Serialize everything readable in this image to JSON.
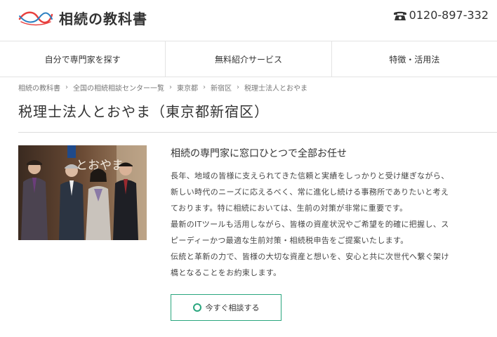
{
  "header": {
    "logo_text": "相続の教科書",
    "phone": "0120-897-332"
  },
  "nav": {
    "items": [
      {
        "label": "自分で専門家を探す"
      },
      {
        "label": "無料紹介サービス"
      },
      {
        "label": "特徴・活用法"
      }
    ]
  },
  "breadcrumb": {
    "items": [
      {
        "label": "相続の教科書"
      },
      {
        "label": "全国の相続相談センター一覧"
      },
      {
        "label": "東京都"
      },
      {
        "label": "新宿区"
      },
      {
        "label": "税理士法人とおやま"
      }
    ],
    "separator": "›"
  },
  "page": {
    "title": "税理士法人とおやま（東京都新宿区）"
  },
  "photo": {
    "sign_text": "とおやま"
  },
  "content": {
    "subtitle": "相続の専門家に窓口ひとつで全部お任せ",
    "lines": [
      "長年、地域の皆様に支えられてきた信頼と実績をしっかりと受け継ぎながら、",
      "新しい時代のニーズに応えるべく、常に進化し続ける事務所でありたいと考え",
      "ております。特に相続においては、生前の対策が非常に重要です。",
      "最新のITツールも活用しながら、皆様の資産状況やご希望を的確に把握し、ス",
      "ピーディーかつ最適な生前対策・相続税申告をご提案いたします。",
      "伝統と革新の力で、皆様の大切な資産と想いを、安心と共に次世代へ繋ぐ架け",
      "橋となることをお約束します。"
    ]
  },
  "cta": {
    "label": "今すぐ相談する"
  },
  "colors": {
    "accent": "#2aa67e",
    "logo_red": "#e8403e",
    "logo_blue": "#2b7fc1"
  },
  "icons": [
    "logo-wave-icon",
    "phone-icon",
    "circle-icon"
  ]
}
